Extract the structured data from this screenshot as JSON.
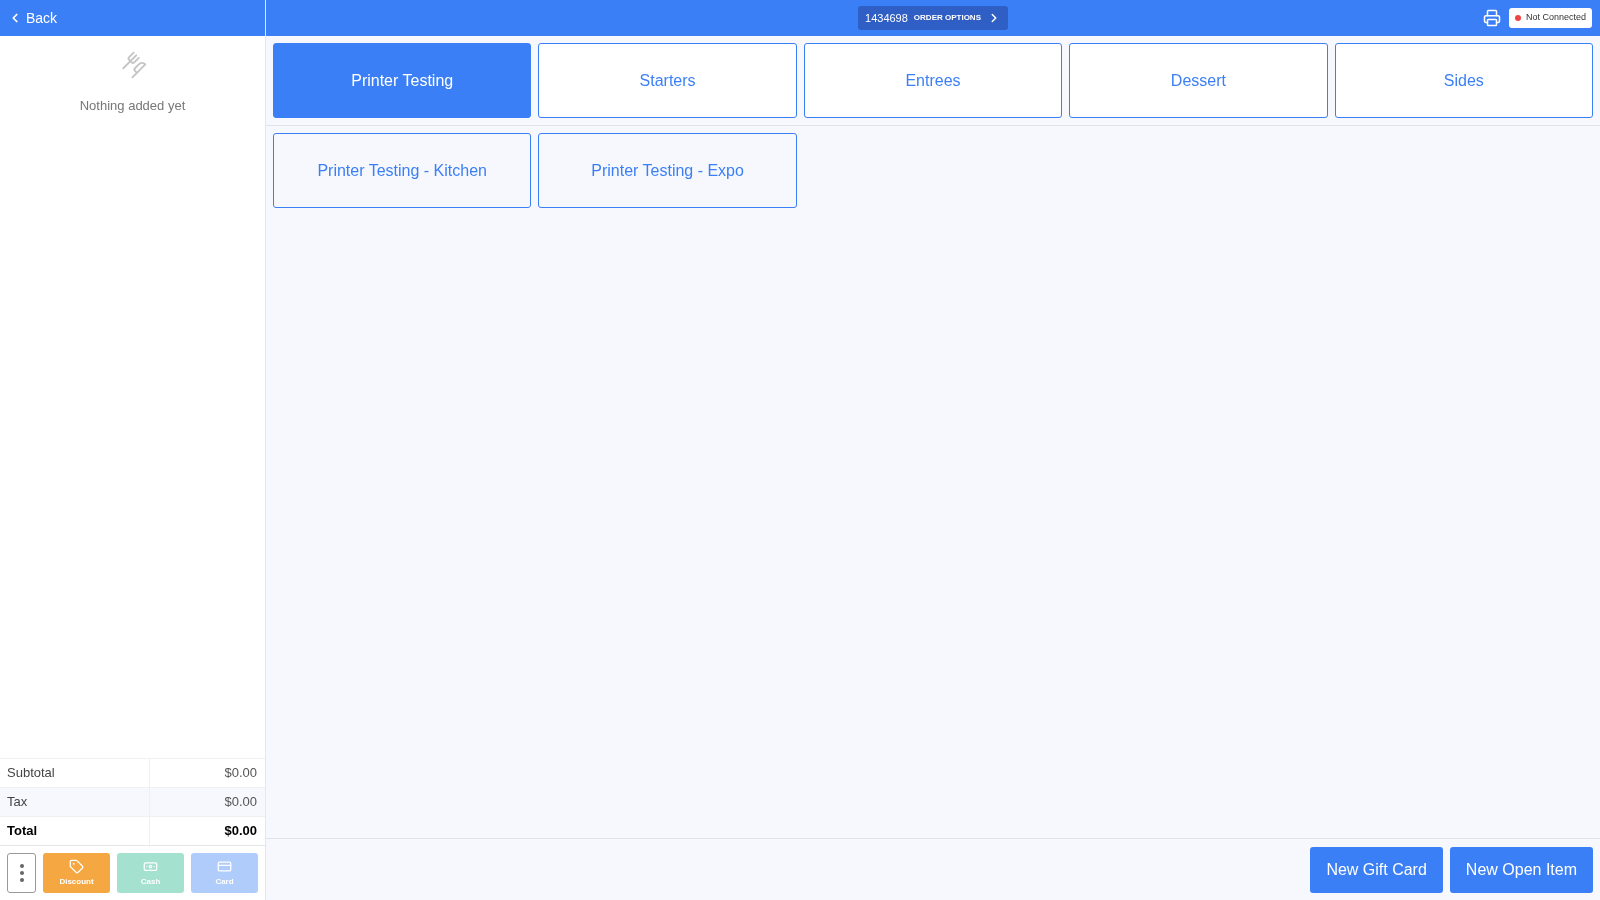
{
  "sidebar": {
    "back": "Back",
    "empty_message": "Nothing added yet",
    "totals": [
      {
        "label": "Subtotal",
        "value": "$0.00",
        "kind": "normal"
      },
      {
        "label": "Tax",
        "value": "$0.00",
        "kind": "normal"
      },
      {
        "label": "Total",
        "value": "$0.00",
        "kind": "total"
      }
    ],
    "actions": [
      {
        "label": "Discount",
        "kind": "discount",
        "disabled": false
      },
      {
        "label": "Cash",
        "kind": "cash",
        "disabled": true
      },
      {
        "label": "Card",
        "kind": "card",
        "disabled": true
      }
    ]
  },
  "header": {
    "order_number": "1434698",
    "order_options": "ORDER OPTIONS",
    "connection": "Not Connected",
    "connected": false
  },
  "categories": [
    {
      "label": "Printer Testing",
      "selected": true
    },
    {
      "label": "Starters",
      "selected": false
    },
    {
      "label": "Entrees",
      "selected": false
    },
    {
      "label": "Dessert",
      "selected": false
    },
    {
      "label": "Sides",
      "selected": false
    }
  ],
  "items": [
    "Printer Testing - Kitchen",
    "Printer Testing - Expo"
  ],
  "footer_buttons": [
    "New Gift Card",
    "New Open Item"
  ]
}
